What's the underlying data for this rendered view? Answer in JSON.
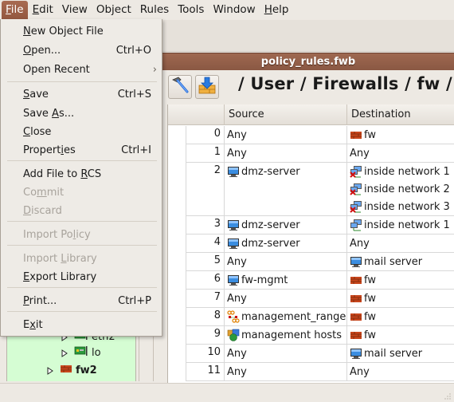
{
  "menubar": {
    "items": [
      {
        "label": "File",
        "mnemonic": "F",
        "rest": "ile",
        "active": true
      },
      {
        "label": "Edit",
        "mnemonic": "E",
        "rest": "dit"
      },
      {
        "label": "View",
        "mnemonic": "",
        "rest": "View"
      },
      {
        "label": "Object",
        "mnemonic": "",
        "rest": "Object"
      },
      {
        "label": "Rules",
        "mnemonic": "",
        "rest": "Rules"
      },
      {
        "label": "Tools",
        "mnemonic": "",
        "rest": "Tools"
      },
      {
        "label": "Window",
        "mnemonic": "",
        "rest": "Window"
      },
      {
        "label": "Help",
        "mnemonic": "H",
        "rest": "elp"
      }
    ]
  },
  "file_menu": {
    "items": [
      {
        "label": "New Object File",
        "pre": "",
        "mn": "N",
        "post": "ew Object File",
        "accel": "",
        "enabled": true
      },
      {
        "label": "Open...",
        "pre": "",
        "mn": "O",
        "post": "pen...",
        "accel": "Ctrl+O",
        "enabled": true
      },
      {
        "label": "Open Recent",
        "pre": "Open Recent",
        "mn": "",
        "post": "",
        "accel": "",
        "submenu": true,
        "enabled": true
      },
      {
        "label": "Save",
        "pre": "",
        "mn": "S",
        "post": "ave",
        "accel": "Ctrl+S",
        "enabled": true
      },
      {
        "label": "Save As...",
        "pre": "Save ",
        "mn": "A",
        "post": "s...",
        "accel": "",
        "enabled": true
      },
      {
        "label": "Close",
        "pre": "",
        "mn": "C",
        "post": "lose",
        "accel": "",
        "enabled": true
      },
      {
        "label": "Properties",
        "pre": "Propert",
        "mn": "i",
        "post": "es",
        "accel": "Ctrl+I",
        "enabled": true
      },
      {
        "label": "Add File to RCS",
        "pre": "Add File to ",
        "mn": "R",
        "post": "CS",
        "accel": "",
        "enabled": true
      },
      {
        "label": "Commit",
        "pre": "Co",
        "mn": "m",
        "post": "mit",
        "accel": "",
        "enabled": false
      },
      {
        "label": "Discard",
        "pre": "",
        "mn": "D",
        "post": "iscard",
        "accel": "",
        "enabled": false
      },
      {
        "label": "Import Policy",
        "pre": "Import Po",
        "mn": "l",
        "post": "icy",
        "accel": "",
        "enabled": false
      },
      {
        "label": "Import Library",
        "pre": "Import ",
        "mn": "L",
        "post": "ibrary",
        "accel": "",
        "enabled": false
      },
      {
        "label": "Export Library",
        "pre": "",
        "mn": "E",
        "post": "xport Library",
        "accel": "",
        "enabled": true
      },
      {
        "label": "Print...",
        "pre": "",
        "mn": "P",
        "post": "rint...",
        "accel": "Ctrl+P",
        "enabled": true
      },
      {
        "label": "Exit",
        "pre": "E",
        "mn": "x",
        "post": "it",
        "accel": "",
        "enabled": true
      }
    ]
  },
  "tree": {
    "items": [
      {
        "label": "eth2",
        "icon": "network-interface-icon",
        "bold": false
      },
      {
        "label": "lo",
        "icon": "network-interface-icon",
        "bold": false
      },
      {
        "label": "fw2",
        "icon": "firewall-icon",
        "bold": true
      }
    ]
  },
  "document": {
    "title": "policy_rules.fwb",
    "path": "/ User / Firewalls / fw / Po",
    "tools": {
      "compile_tooltip": "compile-icon",
      "install_tooltip": "install-icon"
    },
    "columns": [
      "",
      "Source",
      "Destination"
    ],
    "rules": [
      {
        "num": "0",
        "source": [
          {
            "text": "Any",
            "icon": ""
          }
        ],
        "destination": [
          {
            "text": "fw",
            "icon": "firewall"
          }
        ]
      },
      {
        "num": "1",
        "source": [
          {
            "text": "Any",
            "icon": ""
          }
        ],
        "destination": [
          {
            "text": "Any",
            "icon": ""
          }
        ]
      },
      {
        "num": "2",
        "source": [
          {
            "text": "dmz-server",
            "icon": "host"
          }
        ],
        "destination": [
          {
            "text": "inside network 1",
            "icon": "network-negated"
          },
          {
            "text": "inside network 2",
            "icon": "network-negated"
          },
          {
            "text": "inside network 3",
            "icon": "network-negated"
          }
        ]
      },
      {
        "num": "3",
        "source": [
          {
            "text": "dmz-server",
            "icon": "host"
          }
        ],
        "destination": [
          {
            "text": "inside network 1",
            "icon": "network"
          }
        ]
      },
      {
        "num": "4",
        "source": [
          {
            "text": "dmz-server",
            "icon": "host"
          }
        ],
        "destination": [
          {
            "text": "Any",
            "icon": ""
          }
        ]
      },
      {
        "num": "5",
        "source": [
          {
            "text": "Any",
            "icon": ""
          }
        ],
        "destination": [
          {
            "text": "mail server",
            "icon": "host"
          }
        ]
      },
      {
        "num": "6",
        "source": [
          {
            "text": "fw-mgmt",
            "icon": "host"
          }
        ],
        "destination": [
          {
            "text": "fw",
            "icon": "firewall"
          }
        ]
      },
      {
        "num": "7",
        "source": [
          {
            "text": "Any",
            "icon": ""
          }
        ],
        "destination": [
          {
            "text": "fw",
            "icon": "firewall"
          }
        ]
      },
      {
        "num": "8",
        "source": [
          {
            "text": "management_range",
            "icon": "address-range"
          }
        ],
        "destination": [
          {
            "text": "fw",
            "icon": "firewall"
          }
        ]
      },
      {
        "num": "9",
        "source": [
          {
            "text": "management hosts",
            "icon": "object-group"
          }
        ],
        "destination": [
          {
            "text": "fw",
            "icon": "firewall"
          }
        ]
      },
      {
        "num": "10",
        "source": [
          {
            "text": "Any",
            "icon": ""
          }
        ],
        "destination": [
          {
            "text": "mail server",
            "icon": "host"
          }
        ]
      },
      {
        "num": "11",
        "source": [
          {
            "text": "Any",
            "icon": ""
          }
        ],
        "destination": [
          {
            "text": "Any",
            "icon": ""
          }
        ]
      }
    ]
  },
  "colors": {
    "menu_active": "#9e6850",
    "title_bar": "#9e6850",
    "tree_bg": "#d5fdd3",
    "disabled_text": "#a8a39c"
  }
}
